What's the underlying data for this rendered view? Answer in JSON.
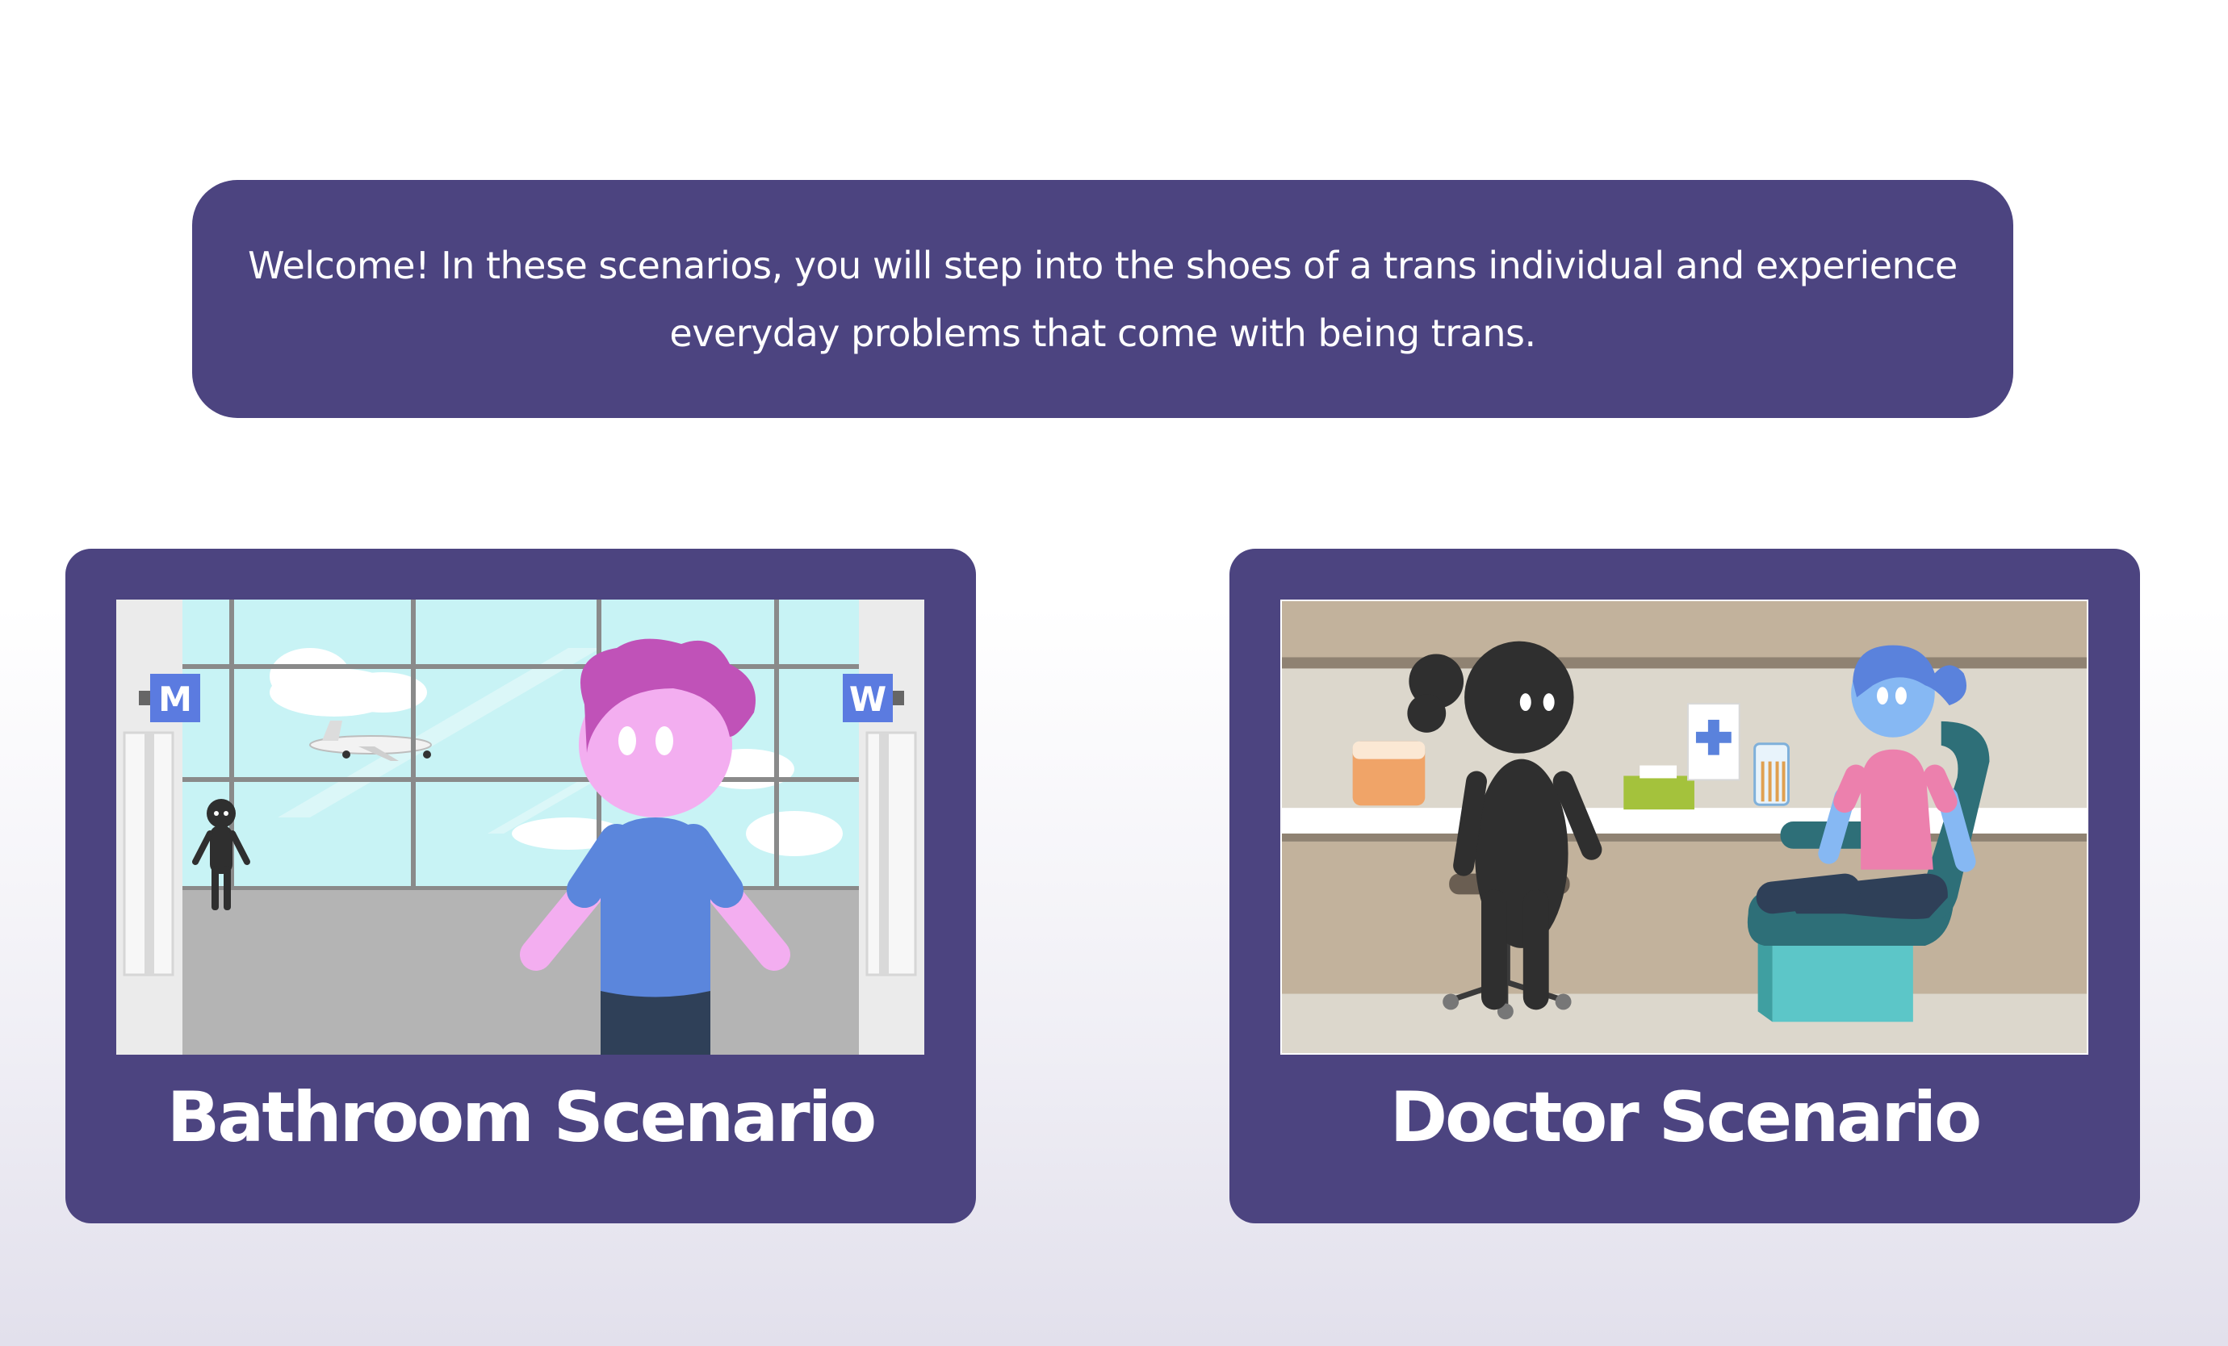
{
  "intro": {
    "text": "Welcome! In these scenarios, you will step into the shoes of a trans individual and experience everyday problems that come with being trans."
  },
  "scenarios": [
    {
      "title": "Bathroom Scenario",
      "image_icon": "airport-bathroom-illustration",
      "signs": [
        "M",
        "W"
      ]
    },
    {
      "title": "Doctor Scenario",
      "image_icon": "doctor-office-illustration"
    }
  ],
  "colors": {
    "panel": "#4c4480",
    "text": "#ffffff"
  }
}
